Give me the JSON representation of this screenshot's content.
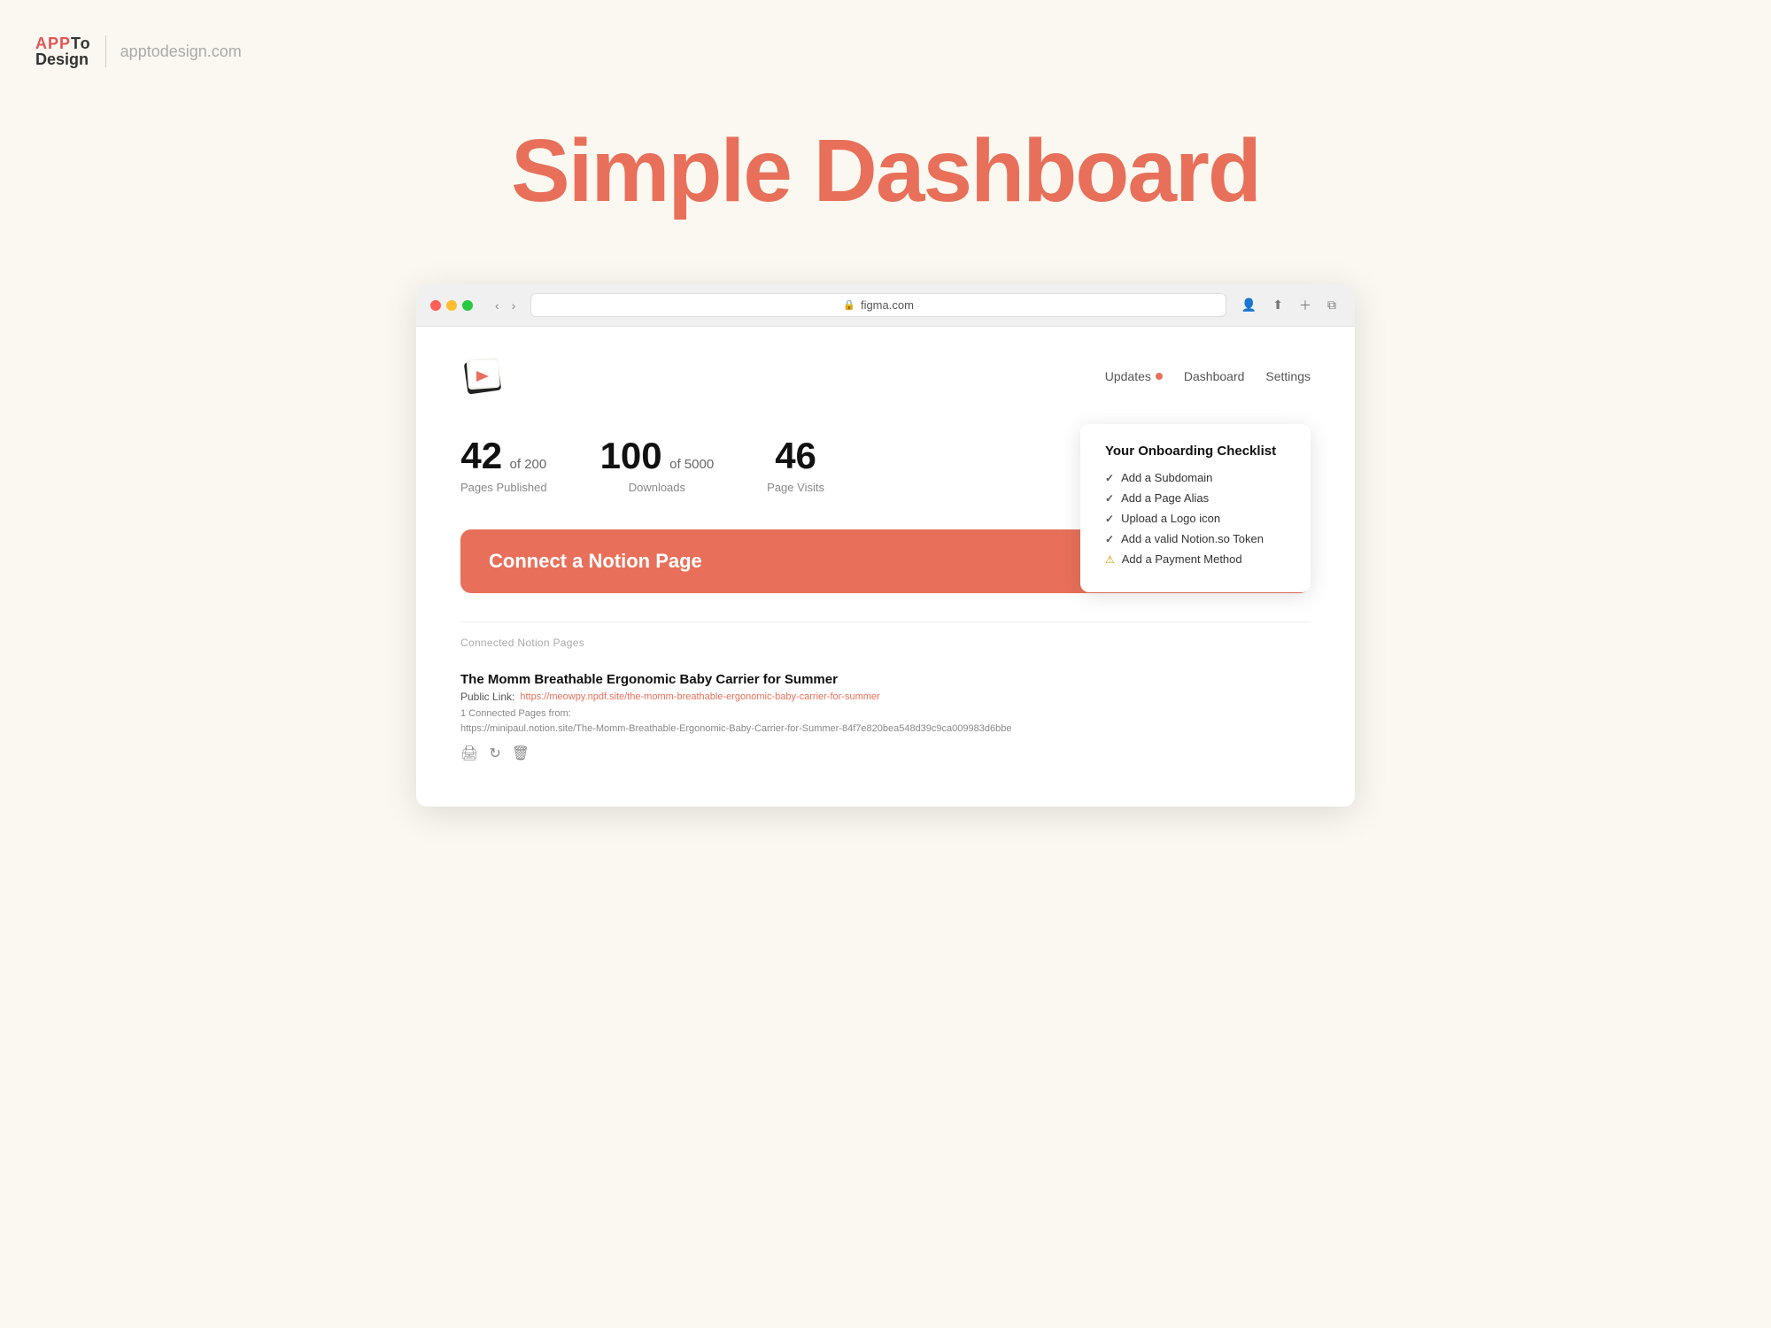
{
  "topbar": {
    "logo_app": "APP",
    "logo_to": "To",
    "logo_design": "Design",
    "site_url": "apptodesign.com"
  },
  "page_title": "Simple Dashboard",
  "browser": {
    "address": "figma.com",
    "tab_label": "figma.com"
  },
  "nav": {
    "updates_label": "Updates",
    "dashboard_label": "Dashboard",
    "settings_label": "Settings"
  },
  "stats": [
    {
      "number": "42",
      "of_label": "of 200",
      "label": "Pages Published"
    },
    {
      "number": "100",
      "of_label": "of 5000",
      "label": "Downloads"
    },
    {
      "number": "46",
      "of_label": "",
      "label": "Page Visits"
    }
  ],
  "checklist": {
    "title": "Your Onboarding Checklist",
    "items": [
      {
        "icon": "check",
        "text": "Add a Subdomain"
      },
      {
        "icon": "check",
        "text": "Add a Page Alias"
      },
      {
        "icon": "check",
        "text": "Upload a Logo icon"
      },
      {
        "icon": "check",
        "text": "Add a valid Notion.so Token"
      },
      {
        "icon": "warning",
        "text": "Add a Payment Method"
      }
    ]
  },
  "cta": {
    "label": "Connect a Notion Page",
    "arrow": "→"
  },
  "connected_section": {
    "label": "Connected Notion Pages",
    "pages": [
      {
        "title": "The Momm Breathable Ergonomic Baby Carrier for Summer",
        "link_label": "Public Link:",
        "link_url": "https://meowpy.npdf.site/the-momm-breathable-ergonomic-baby-carrier-for-summer",
        "connected_from_label": "1 Connected Pages from:",
        "connected_from_url": "https://minipaul.notion.site/The-Momm-Breathable-Ergonomic-Baby-Carrier-for-Summer-84f7e820bea548d39c9ca009983d6bbe"
      }
    ]
  },
  "colors": {
    "brand": "#e8705a",
    "accent_dot": "#e8705a"
  }
}
